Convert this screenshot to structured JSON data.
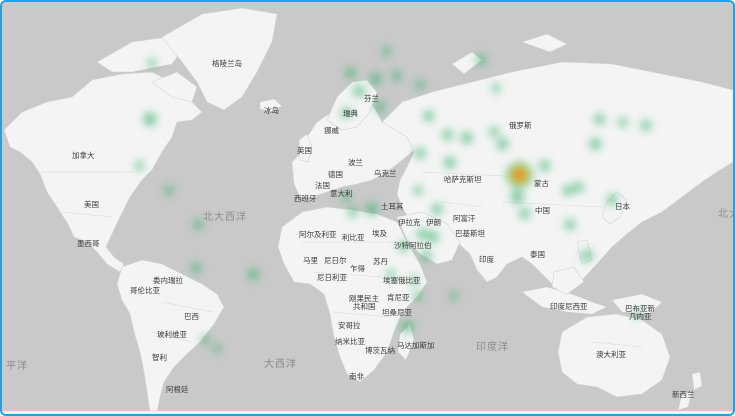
{
  "map": {
    "colors": {
      "ocean": "#c9c9c9",
      "land": "#f4f4f4",
      "border": "#cfcfcf",
      "frame": "#1aa3e8",
      "heat_low": "#2fb36a",
      "heat_mid": "#f0c419",
      "heat_high": "#e02020"
    },
    "oceans": {
      "north_atlantic": "北大西洋",
      "north_atlantic_right": "北大",
      "south_atlantic": "大西洋",
      "indian": "印度洋",
      "pacific_left": "平洋"
    },
    "countries": {
      "greenland": "格陵兰岛",
      "iceland": "冰岛",
      "canada": "加拿大",
      "usa": "美国",
      "mexico": "墨西哥",
      "venezuela": "委内瑞拉",
      "colombia": "哥伦比亚",
      "brazil": "巴西",
      "bolivia": "玻利维亚",
      "chile": "智利",
      "argentina": "阿根廷",
      "norway": "挪威",
      "sweden": "瑞典",
      "finland": "芬兰",
      "uk": "英国",
      "germany": "德国",
      "france": "法国",
      "poland": "波兰",
      "ukraine": "乌克兰",
      "spain": "西班牙",
      "italy": "意大利",
      "turkey": "土耳其",
      "kazakhstan": "哈萨克斯坦",
      "russia": "俄罗斯",
      "mongolia": "蒙古",
      "china": "中国",
      "japan": "日本",
      "iran": "伊朗",
      "iraq": "伊拉克",
      "afghanistan": "阿富汗",
      "pakistan": "巴基斯坦",
      "india": "印度",
      "saudi": "沙特阿拉伯",
      "egypt": "埃及",
      "libya": "利比亚",
      "algeria": "阿尔及利亚",
      "mali": "马里",
      "niger": "尼日尔",
      "chad": "乍得",
      "sudan": "苏丹",
      "nigeria": "尼日利亚",
      "ethiopia": "埃塞俄比亚",
      "drc_1": "刚果民主",
      "drc_2": "共和国",
      "kenya": "肯尼亚",
      "tanzania": "坦桑尼亚",
      "angola": "安哥拉",
      "namibia": "纳米比亚",
      "botswana": "博茨瓦纳",
      "madagascar": "马达加斯加",
      "south_africa": "南非",
      "thailand": "泰国",
      "indonesia": "印度尼西亚",
      "png_1": "巴布亚新",
      "png_2": "几内亚",
      "australia": "澳大利亚",
      "new_zealand": "新西兰"
    },
    "hotspots": [
      {
        "name": "united-states",
        "lon": -97,
        "lat": 38,
        "intensity": 0.45
      },
      {
        "name": "canada",
        "lon": -96,
        "lat": 56,
        "intensity": 0.18
      },
      {
        "name": "mexico",
        "lon": -102,
        "lat": 23,
        "intensity": 0.2
      },
      {
        "name": "central-america",
        "lon": -88,
        "lat": 15,
        "intensity": 0.22
      },
      {
        "name": "colombia",
        "lon": -74,
        "lat": 4,
        "intensity": 0.25
      },
      {
        "name": "peru",
        "lon": -75,
        "lat": -10,
        "intensity": 0.28
      },
      {
        "name": "brazil",
        "lon": -48,
        "lat": -12,
        "intensity": 0.32
      },
      {
        "name": "chile",
        "lon": -71,
        "lat": -33,
        "intensity": 0.18
      },
      {
        "name": "argentina",
        "lon": -65,
        "lat": -36,
        "intensity": 0.15
      },
      {
        "name": "uk",
        "lon": -2,
        "lat": 53,
        "intensity": 0.3
      },
      {
        "name": "france",
        "lon": 2,
        "lat": 47,
        "intensity": 0.35
      },
      {
        "name": "spain",
        "lon": -4,
        "lat": 40,
        "intensity": 0.28
      },
      {
        "name": "germany",
        "lon": 10,
        "lat": 51,
        "intensity": 0.35
      },
      {
        "name": "italy",
        "lon": 12,
        "lat": 42,
        "intensity": 0.32
      },
      {
        "name": "scandinavia",
        "lon": 15,
        "lat": 60,
        "intensity": 0.2
      },
      {
        "name": "poland",
        "lon": 20,
        "lat": 52,
        "intensity": 0.25
      },
      {
        "name": "ukraine",
        "lon": 31,
        "lat": 49,
        "intensity": 0.22
      },
      {
        "name": "turkey",
        "lon": 35,
        "lat": 39,
        "intensity": 0.3
      },
      {
        "name": "russia",
        "lon": 60,
        "lat": 57,
        "intensity": 0.3
      },
      {
        "name": "kazakhstan",
        "lon": 67,
        "lat": 48,
        "intensity": 0.18
      },
      {
        "name": "iran",
        "lon": 53,
        "lat": 32,
        "intensity": 0.35
      },
      {
        "name": "iraq",
        "lon": 44,
        "lat": 33,
        "intensity": 0.3
      },
      {
        "name": "saudi-arabia",
        "lon": 45,
        "lat": 24,
        "intensity": 0.35
      },
      {
        "name": "egypt",
        "lon": 31,
        "lat": 27,
        "intensity": 0.3
      },
      {
        "name": "afghanistan",
        "lon": 66,
        "lat": 34,
        "intensity": 0.25
      },
      {
        "name": "pakistan",
        "lon": 70,
        "lat": 30,
        "intensity": 0.35
      },
      {
        "name": "india",
        "lon": 78,
        "lat": 20,
        "intensity": 1.0
      },
      {
        "name": "india-south",
        "lon": 77,
        "lat": 13,
        "intensity": 0.45
      },
      {
        "name": "bangladesh",
        "lon": 90,
        "lat": 23,
        "intensity": 0.3
      },
      {
        "name": "sri-lanka",
        "lon": 80.5,
        "lat": 7.5,
        "intensity": 0.3
      },
      {
        "name": "china",
        "lon": 114,
        "lat": 30,
        "intensity": 0.35
      },
      {
        "name": "china-north",
        "lon": 116,
        "lat": 38,
        "intensity": 0.3
      },
      {
        "name": "japan",
        "lon": 138,
        "lat": 36,
        "intensity": 0.28
      },
      {
        "name": "korea",
        "lon": 127,
        "lat": 37,
        "intensity": 0.22
      },
      {
        "name": "thailand",
        "lon": 101,
        "lat": 15,
        "intensity": 0.3
      },
      {
        "name": "vietnam",
        "lon": 106,
        "lat": 16,
        "intensity": 0.28
      },
      {
        "name": "philippines",
        "lon": 122,
        "lat": 12,
        "intensity": 0.3
      },
      {
        "name": "malaysia",
        "lon": 102,
        "lat": 4,
        "intensity": 0.3
      },
      {
        "name": "indonesia",
        "lon": 110,
        "lat": -6,
        "intensity": 0.35
      },
      {
        "name": "nigeria",
        "lon": 8,
        "lat": 9,
        "intensity": 0.4
      },
      {
        "name": "ghana",
        "lon": -1,
        "lat": 8,
        "intensity": 0.25
      },
      {
        "name": "mali",
        "lon": -4,
        "lat": 13,
        "intensity": 0.2
      },
      {
        "name": "sudan",
        "lon": 30,
        "lat": 15,
        "intensity": 0.2
      },
      {
        "name": "ethiopia",
        "lon": 39,
        "lat": 9,
        "intensity": 0.3
      },
      {
        "name": "kenya",
        "lon": 37,
        "lat": 0,
        "intensity": 0.35
      },
      {
        "name": "uganda",
        "lon": 32,
        "lat": 1,
        "intensity": 0.3
      },
      {
        "name": "tanzania",
        "lon": 34,
        "lat": -6,
        "intensity": 0.28
      },
      {
        "name": "drc",
        "lon": 23,
        "lat": -3,
        "intensity": 0.3
      },
      {
        "name": "angola",
        "lon": 17,
        "lat": -12,
        "intensity": 0.18
      },
      {
        "name": "zambia",
        "lon": 28,
        "lat": -14,
        "intensity": 0.2
      },
      {
        "name": "zimbabwe",
        "lon": 30,
        "lat": -19,
        "intensity": 0.22
      },
      {
        "name": "south-africa",
        "lon": 25,
        "lat": -29,
        "intensity": 0.4
      },
      {
        "name": "madagascar",
        "lon": 47,
        "lat": -19,
        "intensity": 0.15
      },
      {
        "name": "australia",
        "lon": 134,
        "lat": -25,
        "intensity": 0.1
      }
    ]
  }
}
